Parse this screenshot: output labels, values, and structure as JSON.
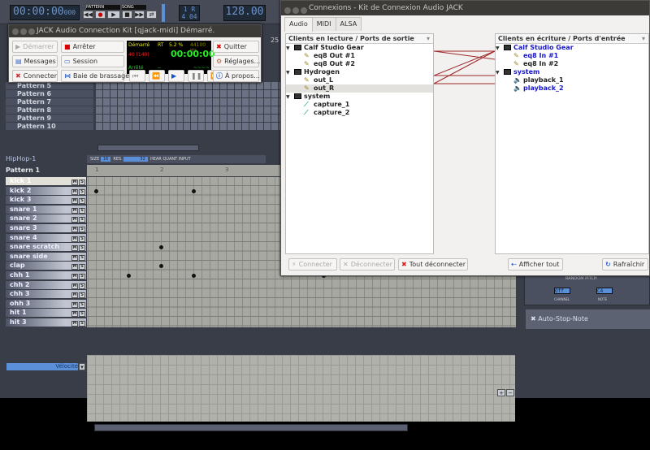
{
  "hydrogen": {
    "transport": {
      "time": "00:00:00",
      "ms": "000",
      "time_labels": [
        "HRS",
        "MIN",
        "SEC",
        "1/1000"
      ],
      "mode_pattern": "PATTERN",
      "mode_song": "SONG",
      "bar": "1",
      "beat_mode": "R",
      "signature": "4 04",
      "bpm": "128.00",
      "bpm_label": "BPM"
    },
    "song_patterns": [
      "Pattern 5",
      "Pattern 6",
      "Pattern 7",
      "Pattern 8",
      "Pattern 9",
      "Pattern 10"
    ],
    "song_ruler_mark": "25",
    "pattern_editor": {
      "song_name": "HipHop-1",
      "size_label": "SIZE",
      "size": "16",
      "res_label": "RES.",
      "res": "32",
      "hear_label": "HEAR",
      "quant_label": "QUANT",
      "input_label": "INPUT",
      "pattern_name": "Pattern 1",
      "beat_labels": [
        "1",
        "2",
        "3"
      ],
      "instruments": [
        {
          "name": "kick 1",
          "notes": []
        },
        {
          "name": "kick 2",
          "notes": [
            0,
            6
          ]
        },
        {
          "name": "kick 3",
          "notes": []
        },
        {
          "name": "snare 1",
          "notes": []
        },
        {
          "name": "snare 2",
          "notes": []
        },
        {
          "name": "snare 3",
          "notes": []
        },
        {
          "name": "snare 4",
          "notes": []
        },
        {
          "name": "snare scratch",
          "notes": [
            4
          ]
        },
        {
          "name": "snare side",
          "notes": []
        },
        {
          "name": "clap",
          "notes": [
            4
          ]
        },
        {
          "name": "chh 1",
          "notes": [
            2,
            6,
            14
          ]
        },
        {
          "name": "chh 2",
          "notes": []
        },
        {
          "name": "chh 3",
          "notes": []
        },
        {
          "name": "ohh 3",
          "notes": []
        },
        {
          "name": "hit 1",
          "notes": []
        },
        {
          "name": "hit 3",
          "notes": []
        }
      ],
      "mute_label": "M",
      "solo_label": "S",
      "velocity_select": "Vélocité"
    },
    "instrument_panel": {
      "random_pitch_label": "RANDOM PITCH",
      "channel_label": "CHANNEL",
      "channel": "Off",
      "note_label": "NOTE",
      "note": "C4",
      "auto_stop_note": "Auto-Stop-Note"
    }
  },
  "jack": {
    "title": "JACK Audio Connection Kit [qjack-midi] Démarré.",
    "buttons": {
      "start": "Démarrer",
      "stop": "Arrêter",
      "messages": "Messages",
      "session": "Session",
      "connect": "Connecter",
      "patchbay": "Baie de brassage",
      "quit": "Quitter",
      "setup": "Réglages...",
      "about": "À propos..."
    },
    "display": {
      "status": "Démarré",
      "rt": "RT",
      "cpu": "5.2 %",
      "rate": "44100 Hz",
      "xruns": "40 (140)",
      "time": "00:00:00",
      "transport": "Arrêté",
      "dash": "--",
      "wave": "~~~~"
    }
  },
  "connections": {
    "title": "Connexions - Kit de Connexion Audio JACK",
    "tabs": [
      "Audio",
      "MIDI",
      "ALSA"
    ],
    "active_tab": "Audio",
    "readable_header": "Clients en lecture / Ports de sortie",
    "writable_header": "Clients en écriture / Ports d'entrée",
    "readable": [
      {
        "client": "Calf Studio Gear",
        "ports": [
          "eq8 Out #1",
          "eq8 Out #2"
        ]
      },
      {
        "client": "Hydrogen",
        "ports": [
          "out_L",
          "out_R"
        ]
      },
      {
        "client": "system",
        "ports": [
          "capture_1",
          "capture_2"
        ]
      }
    ],
    "writable": [
      {
        "client": "Calf Studio Gear",
        "ports": [
          "eq8 In #1",
          "eq8 In #2"
        ]
      },
      {
        "client": "system",
        "ports": [
          "playback_1",
          "playback_2"
        ]
      }
    ],
    "selected_port": "out_R",
    "connection_color": "#a0282a",
    "buttons": {
      "connect": "Connecter",
      "disconnect": "Déconnecter",
      "disconnect_all": "Tout déconnecter",
      "expand_all": "Afficher tout",
      "refresh": "Rafraîchir"
    }
  }
}
